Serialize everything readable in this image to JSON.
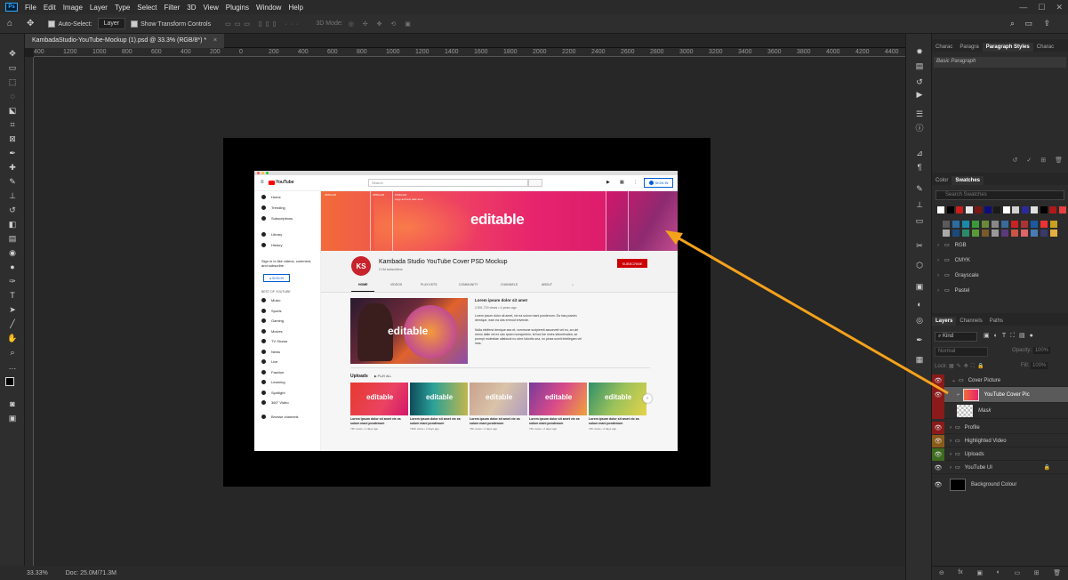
{
  "menu": [
    "File",
    "Edit",
    "Image",
    "Layer",
    "Type",
    "Select",
    "Filter",
    "3D",
    "View",
    "Plugins",
    "Window",
    "Help"
  ],
  "app_icon": "Ps",
  "window_controls": [
    "—",
    "☐",
    "✕"
  ],
  "options": {
    "auto_select_label": "Auto-Select:",
    "auto_select_value": "Layer",
    "show_transform_label": "Show Transform Controls",
    "mode_3d_label": "3D Mode:"
  },
  "document_tab": "KambadaStudio-YouTube-Mockup (1).psd @ 33.3% (RGB/8*) *",
  "ruler_ticks": [
    "400",
    "1200",
    "1000",
    "800",
    "600",
    "400",
    "200",
    "0",
    "200",
    "400",
    "600",
    "800",
    "1000",
    "1200",
    "1400",
    "1600",
    "1800",
    "2000",
    "2200",
    "2400",
    "2600",
    "2800",
    "3000",
    "3200",
    "3400",
    "3600",
    "3800",
    "4000",
    "4200",
    "4400",
    "4600"
  ],
  "status": {
    "zoom": "33.33%",
    "doc": "Doc: 25.0M/71.3M"
  },
  "youtube": {
    "search_placeholder": "Search",
    "sign_in": "SIGN IN",
    "logo": "YouTube",
    "sidebar_main": [
      "Home",
      "Trending",
      "Subscriptions"
    ],
    "sidebar_lib": [
      "Library",
      "History"
    ],
    "signin_prompt": "Sign in to like videos, comment, and subscribe.",
    "best_of": "BEST OF YOUTUBE",
    "best_items": [
      "Music",
      "Sports",
      "Gaming",
      "Movies",
      "TV Shows",
      "News",
      "Live",
      "Fashion",
      "Learning",
      "Spotlight",
      "360° Video"
    ],
    "browse_channels": "Browse channels",
    "banner_text": "editable",
    "banner_labels": [
      "2560x423",
      "1855x423",
      "1546x423",
      "Logo and text safe area"
    ],
    "channel_name": "Kambada Studio YouTube Cover PSD Mockup",
    "subscribers": "2.1M subscribers",
    "subscribe": "SUBSCRIBE",
    "avatar_text": "KS",
    "tabs": [
      "HOME",
      "VIDEOS",
      "PLAYLISTS",
      "COMMUNITY",
      "CHANNELS",
      "ABOUT"
    ],
    "featured_title": "Lorem ipsum dolor sit amet",
    "featured_meta": "2,591,729 views • 4 years ago",
    "featured_desc": "Lorem ipsum dolor sit amet, vix ea solum mani pondenum. Ea has possim demique, eam ea ubs errmod erivende.",
    "featured_desc2": "Nulla eleifend denique sea et, commune sudpiereit assueveit vel eu, an ubi nemo dalle vel ex sdo rpsen numquiriem, tel loa foe mnes stdoretvatea, se prompt molestiae utlaborat no ubre lobortis sea, no pinas somit intellegam vel mas.",
    "featured_thumb_text": "editable",
    "uploads_label": "Uploads",
    "play_all": "PLAY ALL",
    "uploads": [
      {
        "title": "Lorem ipsum dolor sit amet vix ea solum mani pondenum",
        "meta": "73K views • 2 days ago",
        "thumb": "editable"
      },
      {
        "title": "Lorem ipsum dolor sit amet vix ea solum mani pondenum",
        "meta": "730K views • 2 days ago",
        "thumb": "editable"
      },
      {
        "title": "Lorem ipsum dolor sit amet vix ea solum mani pondenum",
        "meta": "73K views • 2 days ago",
        "thumb": "editable"
      },
      {
        "title": "Lorem ipsum dolor sit amet vix ea solum mani pondenum",
        "meta": "73K views • 2 days ago",
        "thumb": "editable"
      },
      {
        "title": "Lorem ipsum dolor sit amet vix ea solum mani pondenum",
        "meta": "73K views • 2 days ago",
        "thumb": "editable"
      }
    ]
  },
  "panels": {
    "top_tabs": [
      "Charac",
      "Paragra",
      "Paragraph Styles",
      "Charac"
    ],
    "paragraph_style": "Basic Paragraph",
    "color_tabs": [
      "Color",
      "Swatches"
    ],
    "search_swatches": "Search Swatches",
    "swatch_groups": [
      "RGB",
      "CMYK",
      "Grayscale",
      "Pastel"
    ],
    "layers_tabs": [
      "Layers",
      "Channels",
      "Paths"
    ],
    "kind_label": "Kind",
    "blend_mode": "Normal",
    "opacity_label": "Opacity:",
    "opacity_value": "100%",
    "lock_label": "Lock:",
    "fill_label": "Fill:",
    "fill_value": "100%",
    "layers": [
      {
        "name": "Cover Picture",
        "type": "folder"
      },
      {
        "name": "YouTube Cover Pic",
        "type": "smart"
      },
      {
        "name": "Mask",
        "type": "mask"
      },
      {
        "name": "Profile",
        "type": "folder"
      },
      {
        "name": "Highlighted Video",
        "type": "folder"
      },
      {
        "name": "Uploads",
        "type": "folder"
      },
      {
        "name": "YouTube UI",
        "type": "folder"
      },
      {
        "name": "Background Colour",
        "type": "fill"
      }
    ]
  },
  "colors": {
    "accent_arrow": "#f5a21b",
    "youtube_red": "#cc0000",
    "layer_red": "#8b1a1a",
    "layer_orange": "#8a5a1a",
    "layer_green": "#3d6b1f"
  }
}
